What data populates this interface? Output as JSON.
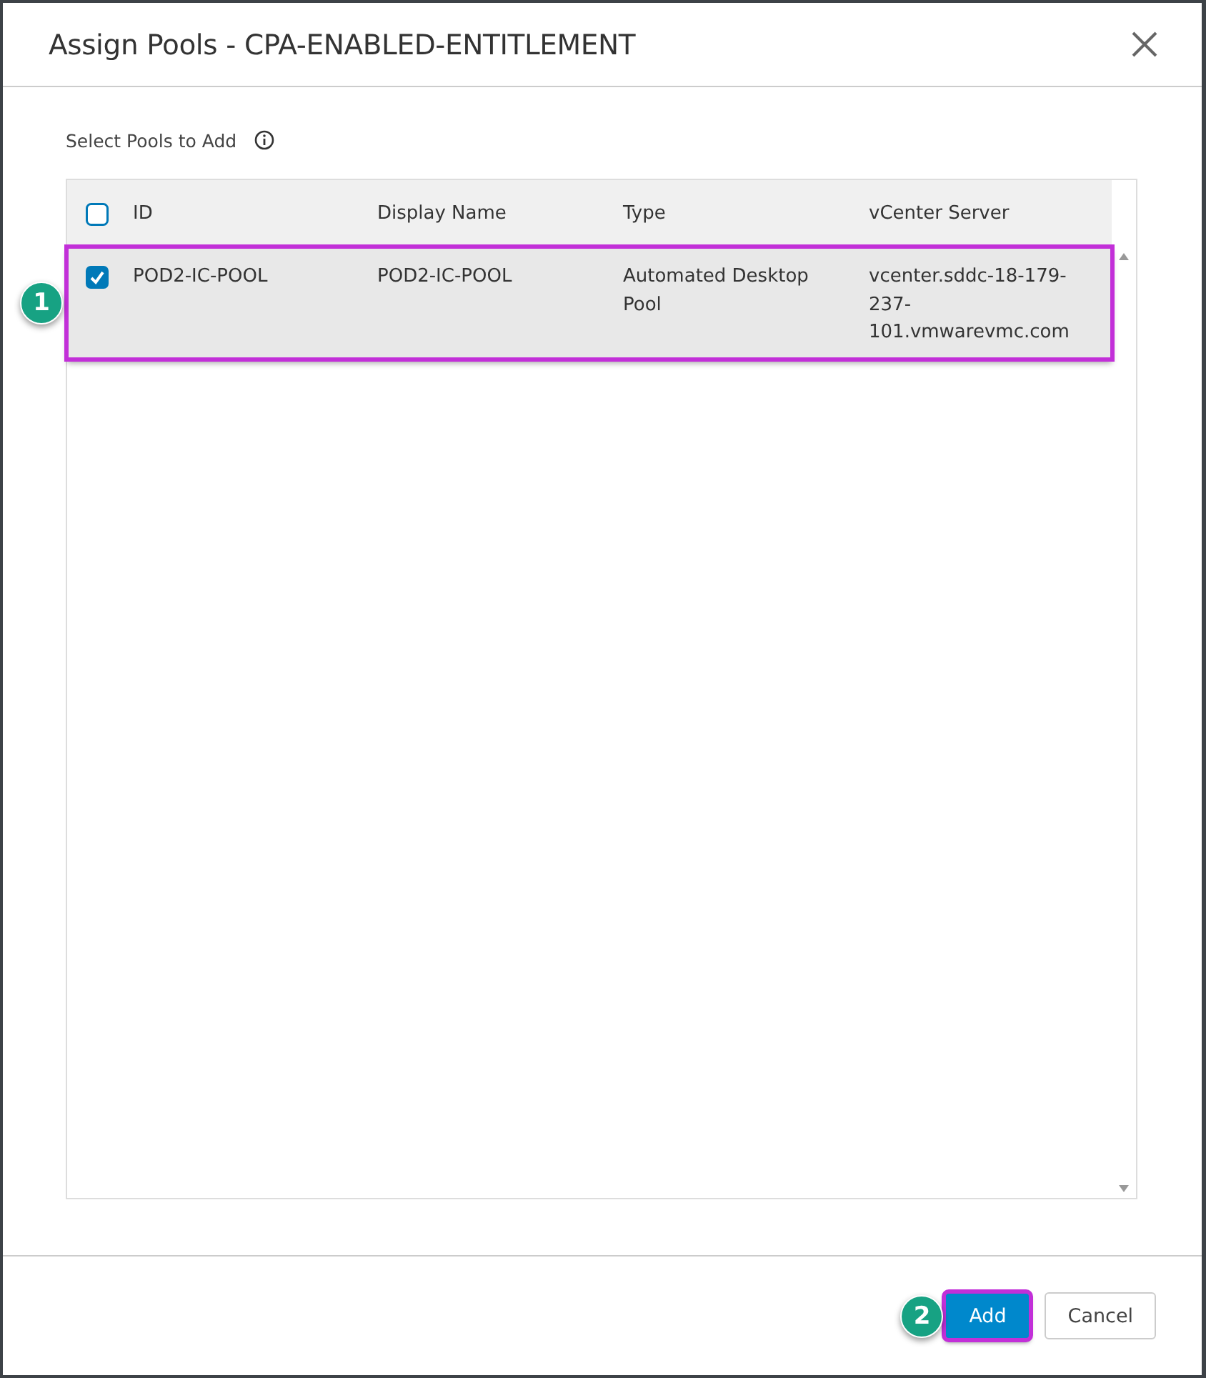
{
  "dialog": {
    "title": "Assign Pools - CPA-ENABLED-ENTITLEMENT"
  },
  "section_label": "Select Pools to Add",
  "table": {
    "select_all_checked": false,
    "columns": [
      "ID",
      "Display Name",
      "Type",
      "vCenter Server"
    ],
    "rows": [
      {
        "cells": [
          "POD2-IC-POOL",
          "POD2-IC-POOL",
          "Automated Desktop Pool",
          "vcenter.sddc-18-179-237-101.vmwarevmc.com"
        ],
        "checked": true,
        "selected": true,
        "highlighted": true,
        "callout": "1"
      }
    ]
  },
  "buttons": [
    {
      "label": "Add",
      "kind": "primary",
      "highlighted": true,
      "callout": "2"
    },
    {
      "label": "Cancel",
      "kind": "secondary",
      "highlighted": false
    }
  ]
}
